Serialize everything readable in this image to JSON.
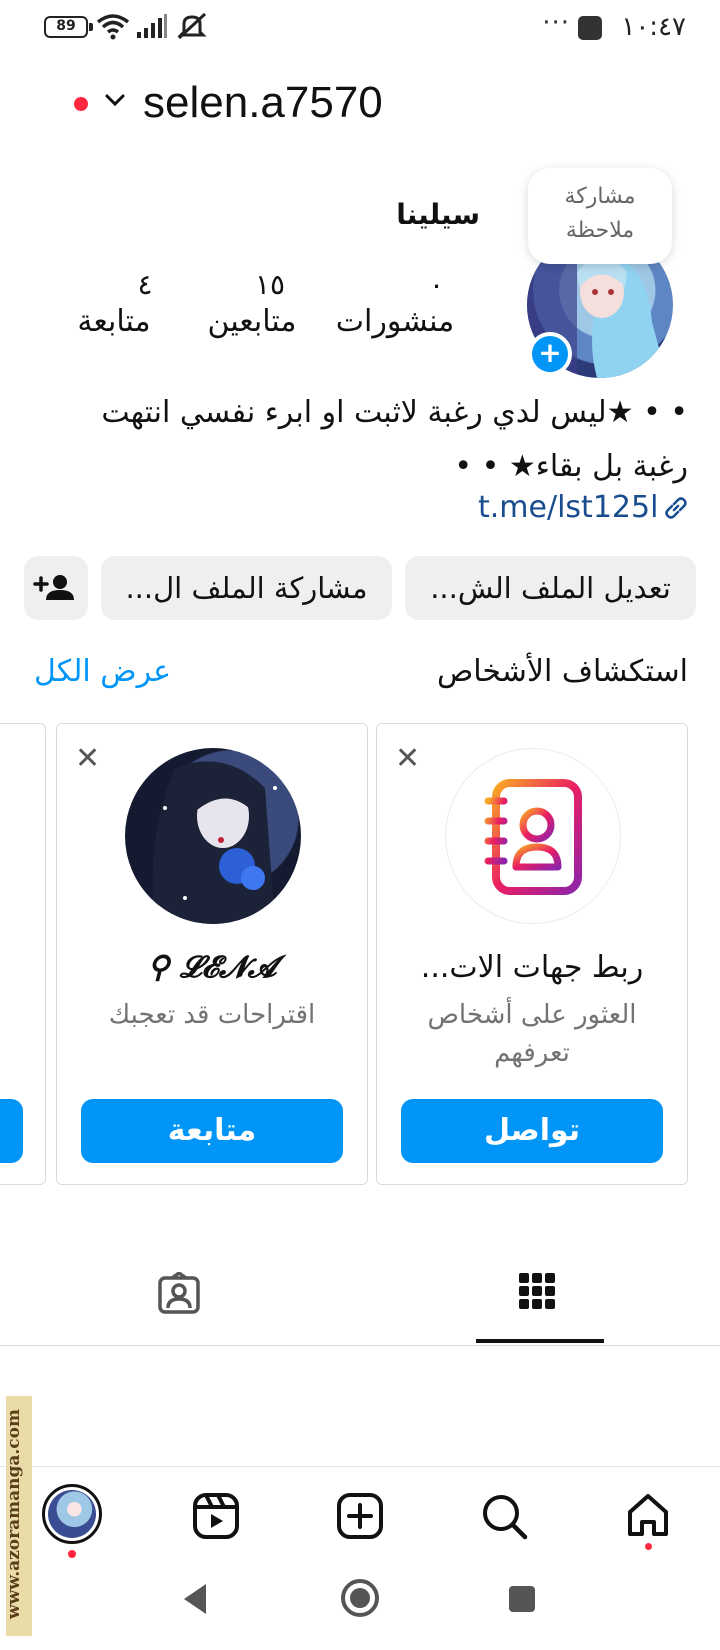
{
  "status_bar": {
    "battery": "89",
    "time": "١٠:٤٧",
    "more": "···"
  },
  "header": {
    "username": "selen.a7570"
  },
  "profile": {
    "note_bubble": "مشاركة ملاحظة",
    "display_name": "سيلينا",
    "stats": {
      "posts": {
        "value": "٠",
        "label": "منشورات"
      },
      "followers": {
        "value": "١٥",
        "label": "متابعين"
      },
      "following": {
        "value": "٤",
        "label": "متابعة"
      }
    },
    "bio_line1": "• • ★ليس لدي رغبة لاثبت او ابرء نفسي انتهت",
    "bio_line2": "رغبة بل بقاء★ • •",
    "link": "t.me/lst125l"
  },
  "actions": {
    "edit_profile": "تعديل الملف الش...",
    "share_profile": "مشاركة الملف ال..."
  },
  "discover": {
    "title": "استكشاف الأشخاص",
    "see_all": "عرض الكل",
    "cards": [
      {
        "title": "ربط جهات الات...",
        "subtitle": "العثور على أشخاص تعرفهم",
        "button": "تواصل"
      },
      {
        "title": "𝓛𝓔𝓝𝓐 ⚲",
        "subtitle": "اقتراحات قد تعجبك",
        "button": "متابعة"
      }
    ]
  },
  "tabs": [
    "grid",
    "tagged"
  ],
  "watermark": "www.azoramanga.com",
  "colors": {
    "accent": "#0095f6",
    "notification": "#ff2740"
  }
}
